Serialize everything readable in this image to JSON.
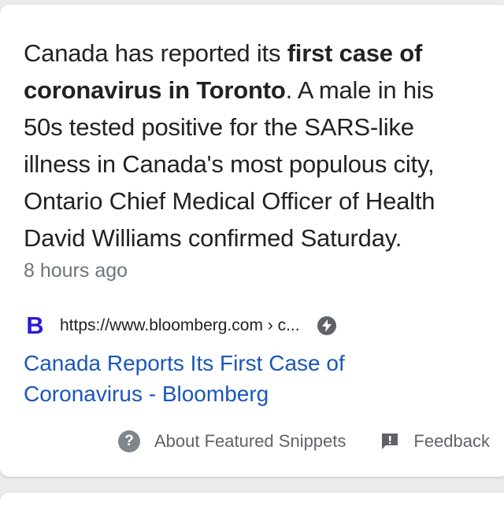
{
  "snippet": {
    "pre": "Canada has reported its ",
    "bold_1": "first case of",
    "bold_2": "coronavirus in Toronto",
    "line2_rest": ". A male in his",
    "line3": "50s tested positive for the SARS-like",
    "line4": "illness in Canada's most populous city,",
    "line5": "Ontario Chief Medical Officer of Health",
    "line6": "David Williams confirmed Saturday."
  },
  "timestamp": "8 hours ago",
  "source": {
    "favicon_letter": "B",
    "url": "https://www.bloomberg.com › c...",
    "amp_icon": "bolt-icon"
  },
  "result_title": {
    "line1": "Canada Reports Its First Case of",
    "line2": "Coronavirus - Bloomberg"
  },
  "footer": {
    "about_label": "About Featured Snippets",
    "feedback_label": "Feedback"
  },
  "colors": {
    "link": "#1a57b8",
    "text": "#222222",
    "muted": "#70757a",
    "favicon": "#2a1bd6"
  }
}
